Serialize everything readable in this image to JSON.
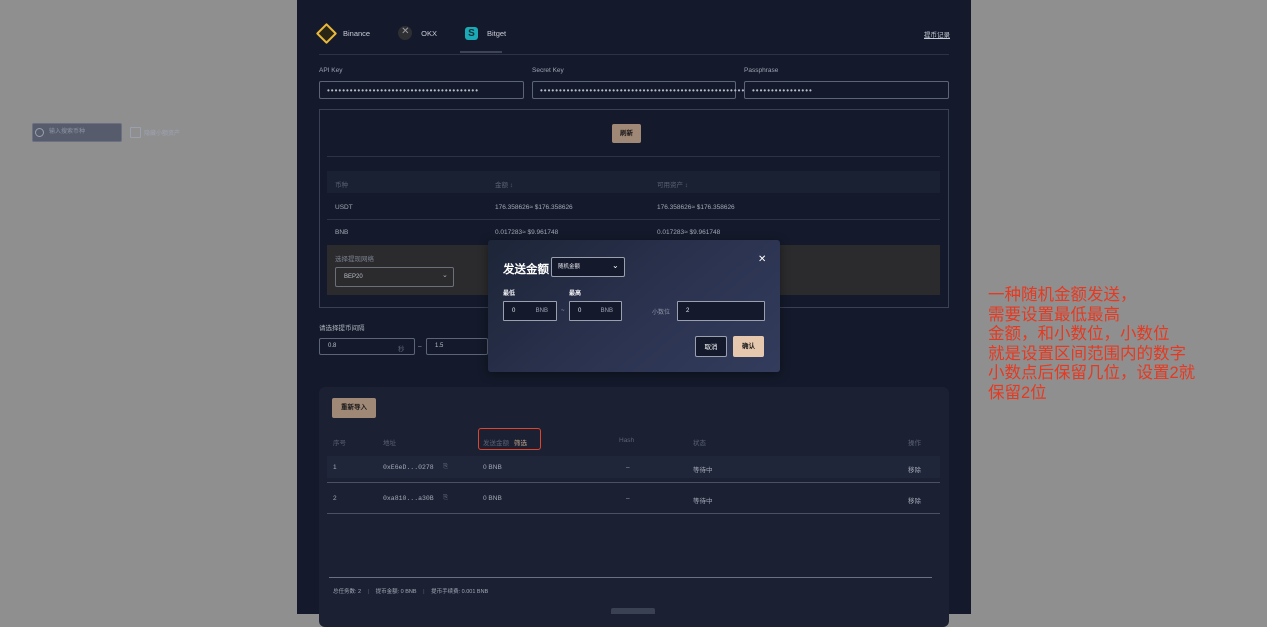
{
  "tabs": [
    {
      "label": "Binance",
      "icon": "binance-icon"
    },
    {
      "label": "OKX",
      "icon": "okx-icon"
    },
    {
      "label": "Bitget",
      "icon": "bitget-icon"
    }
  ],
  "withdraw_records": "提币记录",
  "api": {
    "api_key_label": "API Key",
    "api_key_value": "••••••••••••••••••••••••••••••••••••••••",
    "secret_key_label": "Secret Key",
    "secret_key_value": "•••••••••••••••••••••••••••••••••••••••••••••••••••••••••••••",
    "passphrase_label": "Passphrase",
    "passphrase_value": "••••••••••••••••"
  },
  "assets": {
    "search_placeholder": "输入搜索币种",
    "hide_small_label": "隐藏小额资产",
    "refresh_label": "刷新",
    "headers": [
      "币种",
      "金额 ↕",
      "可用资产 ↕"
    ],
    "rows": [
      {
        "coin": "USDT",
        "amount": "176.358626≈ $176.358626",
        "available": "176.358626≈ $176.358626"
      },
      {
        "coin": "BNB",
        "amount": "0.017283≈ $9.961748",
        "available": "0.017283≈ $9.961748"
      }
    ],
    "network_label": "选择提现网络",
    "network_value": "BEP20"
  },
  "interval": {
    "label": "请选择提币间隔",
    "min_value": "0.8",
    "unit": "秒",
    "separator": "–",
    "max_value": "1.5"
  },
  "tasks": {
    "reimport_label": "重新导入",
    "headers": {
      "no": "序号",
      "address": "地址",
      "amount": "发送金额",
      "filter": "筛选",
      "hash": "Hash",
      "status": "状态",
      "action": "操作"
    },
    "rows": [
      {
        "no": "1",
        "address": "0xE6eD...0278",
        "amount": "0 BNB",
        "hash": "–",
        "status": "等待中",
        "action": "移除"
      },
      {
        "no": "2",
        "address": "0xa810...a30B",
        "amount": "0 BNB",
        "hash": "–",
        "status": "等待中",
        "action": "移除"
      }
    ],
    "footer": {
      "total": "总任务数: 2",
      "amount": "提币金额: 0 BNB",
      "fee": "提币手续费: 0.001 BNB"
    }
  },
  "modal": {
    "title": "发送金额",
    "mode_value": "随机金额",
    "min_label": "最低",
    "max_label": "最高",
    "min_value": "0",
    "max_value": "0",
    "unit": "BNB",
    "tilde": "~",
    "decimal_label": "小数位",
    "decimal_value": "2",
    "cancel_label": "取消",
    "confirm_label": "确认"
  },
  "annotation": {
    "lines": [
      "一种随机金额发送，",
      "需要设置最低最高",
      "金额，和小数位，小数位",
      "就是设置区间范围内的数字",
      "小数点后保留几位，设置2就",
      "保留2位"
    ]
  },
  "colors": {
    "panel_bg": "#141a2b",
    "accent": "#a08876",
    "annotation": "#e8381f",
    "highlight": "#e0452c"
  }
}
